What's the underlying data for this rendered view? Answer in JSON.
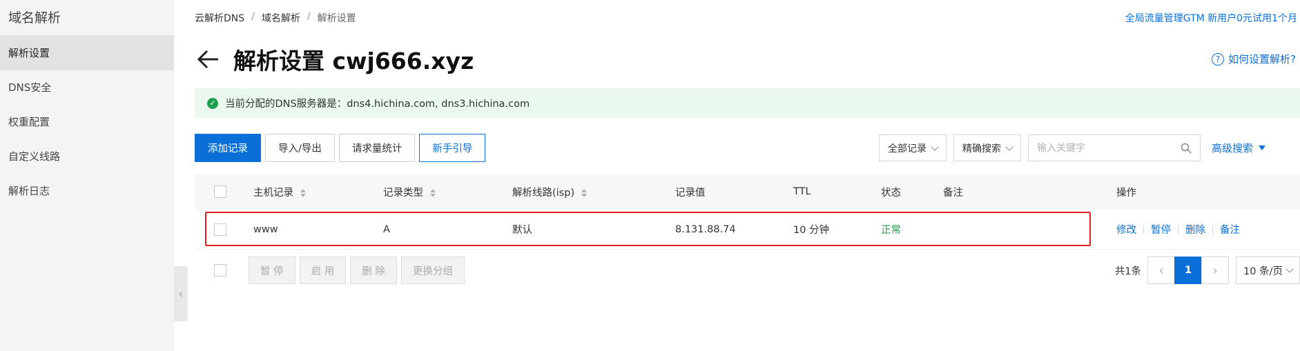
{
  "sidebar": {
    "title": "域名解析",
    "items": [
      {
        "label": "解析设置",
        "active": true
      },
      {
        "label": "DNS安全"
      },
      {
        "label": "权重配置"
      },
      {
        "label": "自定义线路"
      },
      {
        "label": "解析日志"
      }
    ],
    "collapse_glyph": "‹"
  },
  "breadcrumb": [
    "云解析DNS",
    "域名解析",
    "解析设置"
  ],
  "breadcrumb_sep": "/",
  "promo": "全局流量管理GTM 新用户0元试用1个月",
  "page": {
    "title": "解析设置 cwj666.xyz",
    "help": "如何设置解析?",
    "help_glyph": "?"
  },
  "notice": {
    "text": "当前分配的DNS服务器是：dns4.hichina.com, dns3.hichina.com",
    "icon": "check-circle-icon",
    "glyph": "✓"
  },
  "toolbar": {
    "add": "添加记录",
    "import_export": "导入/导出",
    "stats": "请求量统计",
    "guide": "新手引导"
  },
  "filter": {
    "record_select": "全部记录",
    "search_mode": "精确搜索",
    "search_placeholder": "输入关键字",
    "advanced": "高级搜索"
  },
  "table": {
    "headers": {
      "host": "主机记录",
      "type": "记录类型",
      "line": "解析线路(isp)",
      "value": "记录值",
      "ttl": "TTL",
      "status": "状态",
      "remark": "备注",
      "ops": "操作"
    },
    "rows": [
      {
        "host": "www",
        "type": "A",
        "line": "默认",
        "value": "8.131.88.74",
        "ttl": "10 分钟",
        "status": "正常",
        "remark": "",
        "ops": [
          "修改",
          "暂停",
          "删除",
          "备注"
        ]
      }
    ]
  },
  "bulk": [
    "暂 停",
    "启 用",
    "删 除",
    "更换分组"
  ],
  "pager": {
    "total": "共1条",
    "prev": "‹",
    "current": "1",
    "next": "›",
    "page_size": "10 条/页"
  },
  "colors": {
    "accent": "#0a6fd6",
    "success": "#1e9e4f",
    "highlight": "#e02020"
  }
}
